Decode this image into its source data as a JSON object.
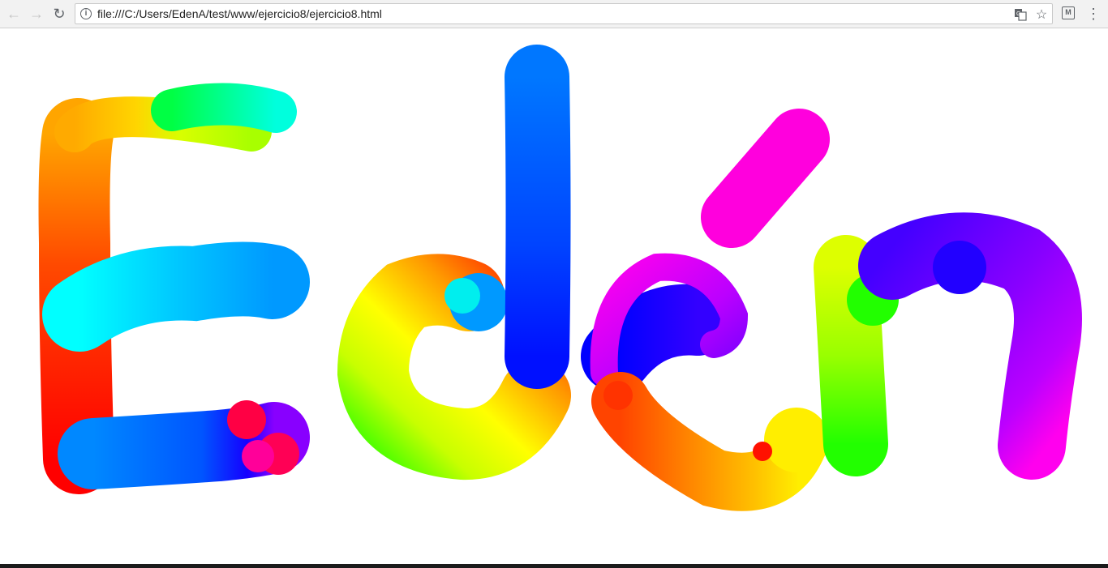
{
  "browser": {
    "back_icon": "arrow-left-icon",
    "forward_icon": "arrow-right-icon",
    "reload_icon": "reload-icon",
    "url": "file:///C:/Users/EdenA/test/www/ejercicio8/ejercicio8.html",
    "info_icon": "info-icon",
    "translate_icon": "translate-icon",
    "bookmark_icon": "star-icon",
    "extension_icon": "extension-icon",
    "menu_icon": "vertical-dots-icon"
  },
  "drawing": {
    "description_colors": [
      "#ff0000",
      "#ff8800",
      "#ffee00",
      "#00ff44",
      "#00ffee",
      "#0099ff",
      "#0000ff",
      "#8800ff",
      "#ff00dd"
    ]
  }
}
